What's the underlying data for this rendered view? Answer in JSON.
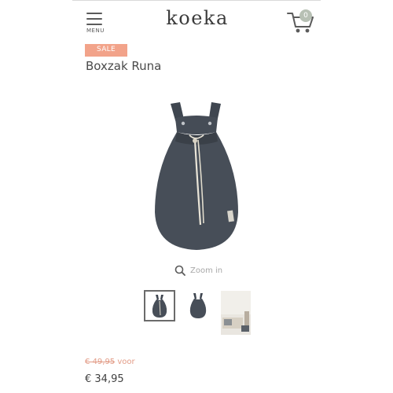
{
  "header": {
    "menu_label": "MENU",
    "logo_text": "koeka",
    "cart_count": "0",
    "cart_badge_color": "#b7c0b4"
  },
  "product": {
    "sale_label": "SALE",
    "sale_color": "#f2a38a",
    "title": "Boxzak Runa",
    "zoom_label": "Zoom in",
    "thumbnails": [
      "bag-front",
      "bag-back",
      "room-scene"
    ],
    "old_price": "€ 49,95",
    "old_price_suffix": "voor",
    "new_price": "€ 34,95"
  },
  "icons": {
    "menu": "hamburger-icon",
    "cart": "cart-icon",
    "zoom": "search-icon"
  }
}
